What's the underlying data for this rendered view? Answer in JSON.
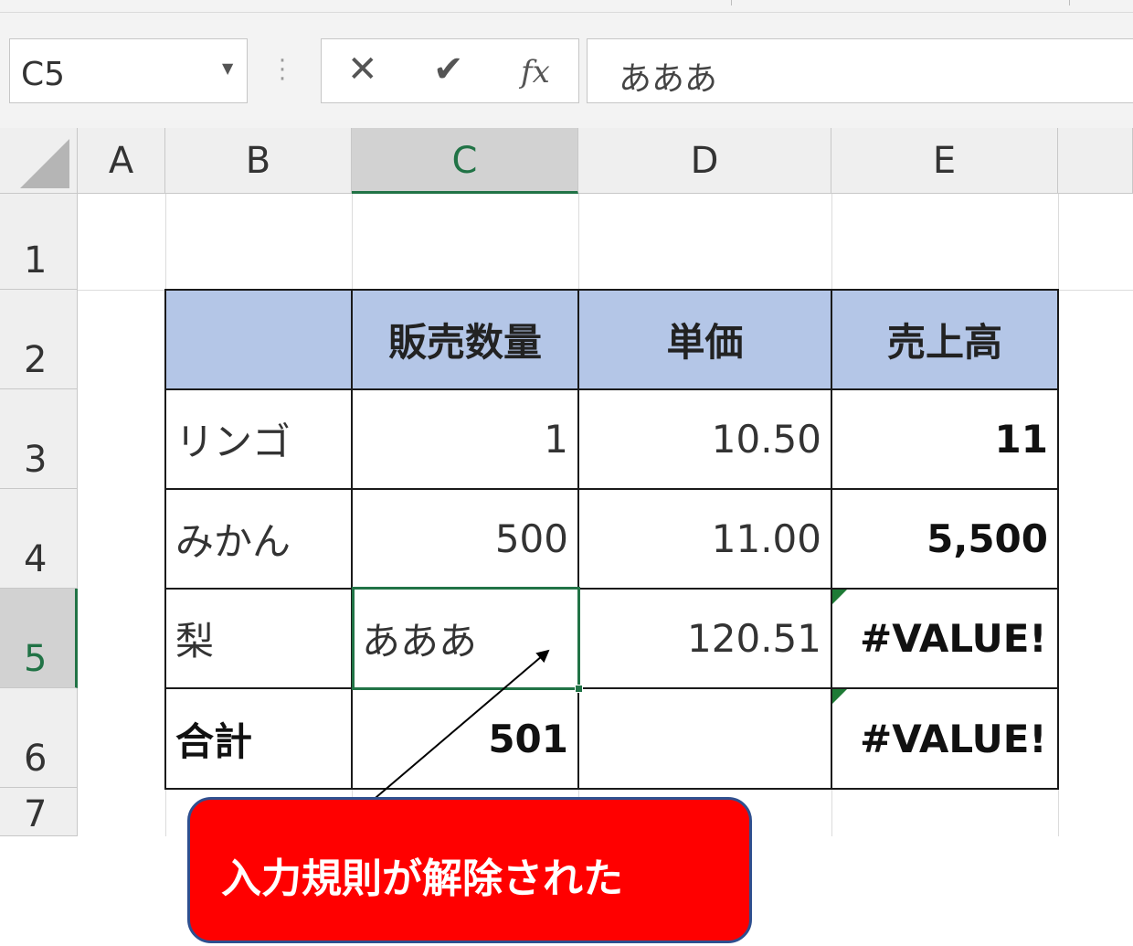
{
  "formula_bar": {
    "name_box": "C5",
    "cancel_icon": "✕",
    "enter_icon": "✔",
    "fx_label": "fx",
    "formula_value": "あああ"
  },
  "columns": [
    "A",
    "B",
    "C",
    "D",
    "E"
  ],
  "rows": [
    "1",
    "2",
    "3",
    "4",
    "5",
    "6",
    "7"
  ],
  "selected": {
    "column": "C",
    "row": "5"
  },
  "table": {
    "header": [
      "",
      "販売数量",
      "単価",
      "売上高"
    ],
    "body": [
      [
        "リンゴ",
        "1",
        "10.50",
        "11"
      ],
      [
        "みかん",
        "500",
        "11.00",
        "5,500"
      ],
      [
        "梨",
        "あああ",
        "120.51",
        "#VALUE!"
      ],
      [
        "合計",
        "501",
        "",
        "#VALUE!"
      ]
    ]
  },
  "colors": {
    "header_fill": "#b4c6e7",
    "selection": "#217346",
    "callout": "#ff0000"
  },
  "callout": {
    "text": "入力規則が解除された"
  }
}
